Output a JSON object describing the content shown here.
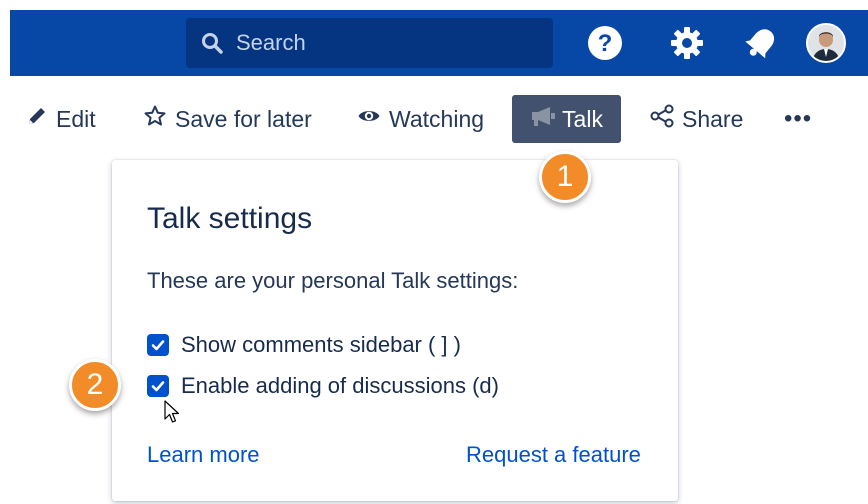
{
  "header": {
    "search_placeholder": "Search",
    "icons": [
      "help-icon",
      "gear-icon",
      "notification-bell-icon",
      "avatar"
    ],
    "bar_color": "#0747a6"
  },
  "toolbar": {
    "edit_label": "Edit",
    "save_label": "Save for later",
    "watch_label": "Watching",
    "talk_label": "Talk",
    "share_label": "Share",
    "more_label": "•••"
  },
  "talk_panel": {
    "title": "Talk settings",
    "description": "These are your personal Talk settings:",
    "options": [
      {
        "label": "Show comments sidebar ( ] )",
        "checked": true
      },
      {
        "label": "Enable adding of discussions (d)",
        "checked": true
      }
    ],
    "learn_more": "Learn more",
    "request_feature": "Request a feature"
  },
  "annotations": {
    "step_1": "1",
    "step_2": "2",
    "badge_color": "#f28c28"
  }
}
